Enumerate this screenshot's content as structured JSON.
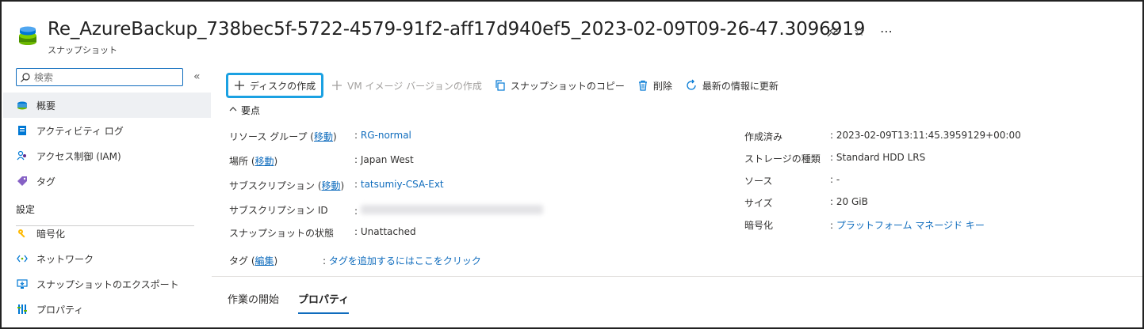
{
  "header": {
    "title": "Re_AzureBackup_738bec5f-5722-4579-91f2-aff17d940ef5_2023-02-09T09-26-47.3096919",
    "resource_type": "スナップショット",
    "actions": [
      "pin-icon",
      "star-icon",
      "more-icon"
    ]
  },
  "sidebar": {
    "search_placeholder": "検索",
    "collapse_glyph": "«",
    "items": [
      {
        "label": "概要",
        "icon": "overview-icon"
      },
      {
        "label": "アクティビティ ログ",
        "icon": "activity-log-icon"
      },
      {
        "label": "アクセス制御 (IAM)",
        "icon": "iam-icon"
      },
      {
        "label": "タグ",
        "icon": "tag-icon"
      }
    ],
    "section_label": "設定",
    "settings_items": [
      {
        "label": "暗号化",
        "icon": "encryption-icon"
      },
      {
        "label": "ネットワーク",
        "icon": "network-icon"
      },
      {
        "label": "スナップショットのエクスポート",
        "icon": "export-icon"
      },
      {
        "label": "プロパティ",
        "icon": "properties-icon"
      }
    ]
  },
  "toolbar": {
    "create_disk": "ディスクの作成",
    "create_vm_image": "VM イメージ バージョンの作成",
    "copy_snapshot": "スナップショットのコピー",
    "delete": "削除",
    "refresh": "最新の情報に更新"
  },
  "essentials": {
    "toggle_label": "要点",
    "left": {
      "resource_group_label": "リソース グループ (",
      "move_link": "移動",
      "close_paren": ")",
      "resource_group_value": "RG-normal",
      "location_label": "場所 (",
      "location_value": "Japan West",
      "subscription_label": "サブスクリプション (",
      "subscription_value": "tatsumiy-CSA-Ext",
      "subscription_id_label": "サブスクリプション ID",
      "snapshot_state_label": "スナップショットの状態",
      "snapshot_state_value": "Unattached"
    },
    "right": {
      "created_label": "作成済み",
      "created_value": "2023-02-09T13:11:45.3959129+00:00",
      "storage_type_label": "ストレージの種類",
      "storage_type_value": "Standard HDD LRS",
      "source_label": "ソース",
      "source_value": "-",
      "size_label": "サイズ",
      "size_value": "20 GiB",
      "encryption_label": "暗号化",
      "encryption_value": "プラットフォーム マネージド キー"
    },
    "tags_label": "タグ (",
    "tags_edit_link": "編集",
    "tags_close": ")",
    "tags_value": "タグを追加するにはここをクリック",
    "colon": ":"
  },
  "tabs": [
    "作業の開始",
    "プロパティ"
  ],
  "colors": {
    "link": "#0f6cbd",
    "highlight": "#1ba1e2",
    "active_bg": "#eef0f3"
  }
}
